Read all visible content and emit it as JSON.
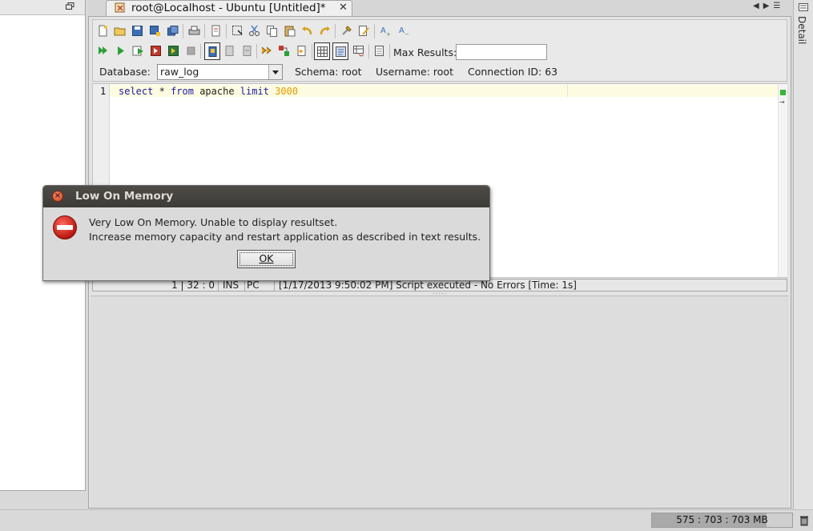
{
  "tab": {
    "title": "root@Localhost - Ubuntu [Untitled]*",
    "close": "✕"
  },
  "right_panel": {
    "label": "Detail"
  },
  "toolbar": {
    "max_results_label": "Max Results:",
    "max_results_value": ""
  },
  "connection": {
    "database_label": "Database:",
    "database_value": "raw_log",
    "schema_label": "Schema:  root",
    "username_label": "Username:  root",
    "connection_id_label": "Connection ID:  63"
  },
  "editor": {
    "line_number": "1",
    "tokens": {
      "select": "select",
      "star": "*",
      "from": "from",
      "table": "apache",
      "limit": "limit",
      "count": "3000"
    }
  },
  "status": {
    "position": "1 | 32 : 0",
    "mode": "INS",
    "platform": "PC",
    "message": "[1/17/2013 9:50:02 PM] Script executed - No Errors [Time: 1s]"
  },
  "memory": {
    "text": "575 : 703 : 703 MB",
    "used_fraction": 0.818
  },
  "dialog": {
    "title": "Low On Memory",
    "line1": "Very Low On Memory. Unable to display resultset.",
    "line2": "Increase memory capacity and restart application as described in text results.",
    "ok_label": "OK"
  },
  "colors": {
    "keyword": "#1a1aa6",
    "number": "#e39a00",
    "current_line": "#fefce0",
    "error": "#d9261c"
  }
}
